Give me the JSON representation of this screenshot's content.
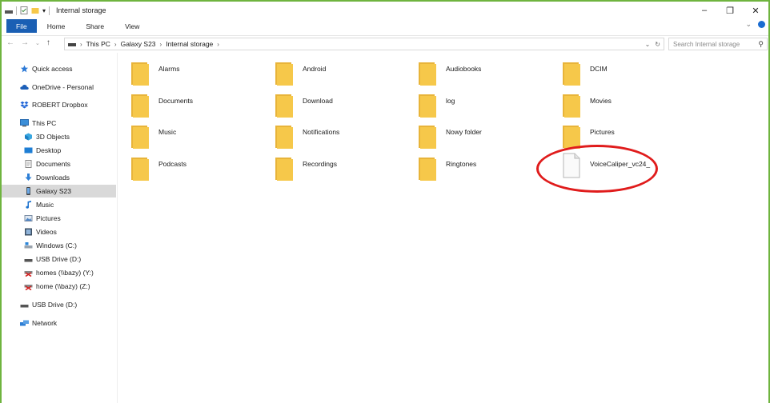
{
  "window": {
    "title": "Internal storage",
    "minimize": "–",
    "restore": "❐",
    "close": "✕"
  },
  "ribbon": {
    "tabs": [
      "File",
      "Home",
      "Share",
      "View"
    ],
    "expand": "⌄"
  },
  "address": {
    "crumbs": [
      "This PC",
      "Galaxy S23",
      "Internal storage"
    ],
    "dropdown": "⌄",
    "refresh": "↻"
  },
  "search": {
    "placeholder": "Search Internal storage"
  },
  "navpane": {
    "items": [
      {
        "label": "Quick access",
        "icon": "star-icon"
      },
      {
        "label": "OneDrive - Personal",
        "icon": "cloud-icon"
      },
      {
        "label": "ROBERT Dropbox",
        "icon": "dropbox-icon"
      },
      {
        "label": "This PC",
        "icon": "computer-icon"
      },
      {
        "label": "3D Objects",
        "icon": "cube-icon"
      },
      {
        "label": "Desktop",
        "icon": "desktop-icon"
      },
      {
        "label": "Documents",
        "icon": "document-icon"
      },
      {
        "label": "Downloads",
        "icon": "download-icon"
      },
      {
        "label": "Galaxy S23",
        "icon": "phone-icon"
      },
      {
        "label": "Music",
        "icon": "music-icon"
      },
      {
        "label": "Pictures",
        "icon": "pictures-icon"
      },
      {
        "label": "Videos",
        "icon": "video-icon"
      },
      {
        "label": "Windows (C:)",
        "icon": "drive-icon"
      },
      {
        "label": "USB Drive (D:)",
        "icon": "usb-drive-icon"
      },
      {
        "label": "homes (\\\\bazy) (Y:)",
        "icon": "network-drive-icon"
      },
      {
        "label": "home (\\\\bazy) (Z:)",
        "icon": "network-drive-icon"
      },
      {
        "label": "USB Drive (D:)",
        "icon": "usb-drive-icon"
      },
      {
        "label": "Network",
        "icon": "network-icon"
      }
    ],
    "selected": "Galaxy S23"
  },
  "files": [
    {
      "name": "Alarms",
      "type": "folder"
    },
    {
      "name": "Android",
      "type": "folder"
    },
    {
      "name": "Audiobooks",
      "type": "folder"
    },
    {
      "name": "DCIM",
      "type": "folder"
    },
    {
      "name": "Documents",
      "type": "folder"
    },
    {
      "name": "Download",
      "type": "folder"
    },
    {
      "name": "log",
      "type": "folder"
    },
    {
      "name": "Movies",
      "type": "folder"
    },
    {
      "name": "Music",
      "type": "folder"
    },
    {
      "name": "Notifications",
      "type": "folder"
    },
    {
      "name": "Nowy folder",
      "type": "folder"
    },
    {
      "name": "Pictures",
      "type": "folder"
    },
    {
      "name": "Podcasts",
      "type": "folder"
    },
    {
      "name": "Recordings",
      "type": "folder"
    },
    {
      "name": "Ringtones",
      "type": "folder"
    },
    {
      "name": "VoiceCaliper_vc24_",
      "type": "file"
    }
  ],
  "colors": {
    "folder": "#f6c84a",
    "accent": "#1a5fb4",
    "annotation": "#e01c1c",
    "frame": "#6fb43f"
  }
}
